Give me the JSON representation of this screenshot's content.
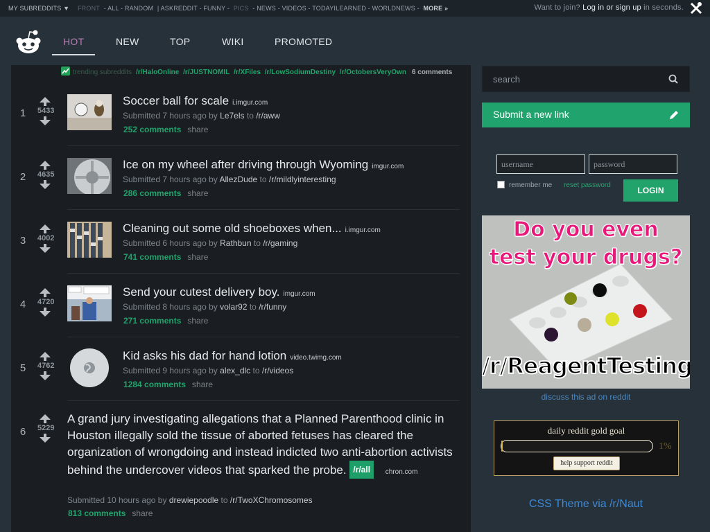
{
  "topbar": {
    "my_subreddits": "MY SUBREDDITS ▼",
    "links": [
      {
        "label": "FRONT",
        "dim": true
      },
      {
        "label": " - ALL - RANDOM",
        "dim": false
      },
      {
        "label": " | ASKREDDIT - FUNNY - ",
        "dim": false
      },
      {
        "label": "PICS",
        "dim": true
      },
      {
        "label": " - NEWS - VIDEOS - TODAYILEARNED - WORLDNEWS - ",
        "dim": false
      }
    ],
    "more": "MORE »",
    "join_text": "Want to join?",
    "login_link": "Log in or sign up",
    "join_suffix": "in seconds.",
    "divider": "|"
  },
  "nav": {
    "tabs": [
      "HOT",
      "NEW",
      "TOP",
      "WIKI",
      "PROMOTED"
    ],
    "active": "HOT"
  },
  "trending": {
    "label": "trending subreddits",
    "subs": [
      "/r/HaloOnline",
      "/r/JUSTNOMIL",
      "/r/XFiles",
      "/r/LowSodiumDestiny",
      "/r/OctobersVeryOwn"
    ],
    "comments": "6 comments"
  },
  "posts": [
    {
      "rank": "1",
      "score": "5433",
      "title": "Soccer ball for scale",
      "domain": "i.imgur.com",
      "time": "7 hours ago",
      "author": "Le7els",
      "sub": "/r/aww",
      "comments": "252 comments",
      "share": "share"
    },
    {
      "rank": "2",
      "score": "4635",
      "title": "Ice on my wheel after driving through Wyoming",
      "domain": "imgur.com",
      "time": "7 hours ago",
      "author": "AllezDude",
      "sub": "/r/mildlyinteresting",
      "comments": "286 comments",
      "share": "share"
    },
    {
      "rank": "3",
      "score": "4002",
      "title": "Cleaning out some old shoeboxes when...",
      "domain": "i.imgur.com",
      "time": "6 hours ago",
      "author": "Rathbun",
      "sub": "/r/gaming",
      "comments": "741 comments",
      "share": "share"
    },
    {
      "rank": "4",
      "score": "4720",
      "title": "Send your cutest delivery boy.",
      "domain": "imgur.com",
      "time": "8 hours ago",
      "author": "volar92",
      "sub": "/r/funny",
      "comments": "271 comments",
      "share": "share"
    },
    {
      "rank": "5",
      "score": "4762",
      "title": "Kid asks his dad for hand lotion",
      "domain": "video.twimg.com",
      "time": "9 hours ago",
      "author": "alex_dlc",
      "sub": "/r/videos",
      "comments": "1284 comments",
      "share": "share"
    },
    {
      "rank": "6",
      "score": "5229",
      "title": "A grand jury investigating allegations that a Planned Parenthood clinic in Houston illegally sold the tissue of aborted fetuses has cleared the organization of wrongdoing and instead indicted two anti-abortion activists behind the undercover videos that sparked the probe.",
      "badge": "/r/all",
      "domain": "chron.com",
      "time": "10 hours ago",
      "author": "drewiepoodle",
      "sub": "/r/TwoXChromosomes",
      "comments": "813 comments",
      "share": "share"
    }
  ],
  "tagline_words": {
    "submitted": "Submitted",
    "by": "by",
    "to": "to"
  },
  "sidebar": {
    "search_placeholder": "search",
    "submit_label": "Submit a new link",
    "username_placeholder": "username",
    "password_placeholder": "password",
    "remember_me": "remember me",
    "reset_password": "reset password",
    "login_label": "LOGIN",
    "ad_headline_1": "Do you even",
    "ad_headline_2": "test your drugs?",
    "ad_sub": "/r/ReagentTesting",
    "discuss_ad": "discuss this ad on reddit",
    "gold_title": "daily reddit gold goal",
    "gold_progress": 0.01,
    "gold_percent": "1%",
    "gold_button": "help support reddit",
    "css_credit": "CSS Theme via /r/Naut"
  },
  "colors": {
    "accent": "#20a36c",
    "active_tab": "#b97fb6",
    "link_blue": "#3e8ad6"
  }
}
